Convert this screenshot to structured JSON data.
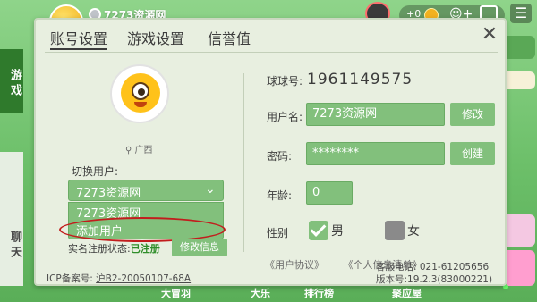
{
  "top": {
    "player_name": "7273资源网",
    "coins_plus": "+0"
  },
  "side": {
    "game_tab": "游戏",
    "chat_tab": "聊天"
  },
  "bottom_nav": [
    "大冒羽",
    "大乐",
    "排行榜",
    "聚应屋"
  ],
  "dialog": {
    "tabs": [
      "账号设置",
      "游戏设置",
      "信誉值"
    ],
    "close_label": "✕",
    "location": "广西",
    "switch_user_label": "切换用户:",
    "selected_user": "7273资源网",
    "dropdown_options": [
      "7273资源网",
      "添加用户"
    ],
    "real_name_label": "实名注册状态:",
    "real_name_status": "已注册",
    "modify_info_button": "修改信息",
    "icp_label": "ICP备案号:",
    "icp_number": "沪B2-20050107-68A",
    "account_no_label": "球球号:",
    "account_no": "1961149575",
    "username_label": "用户名:",
    "username_value": "7273资源网",
    "modify_button": "修改",
    "password_label": "密码:",
    "password_value": "********",
    "create_button": "创建",
    "age_label": "年龄:",
    "age_value": "0",
    "gender_label": "性别",
    "male_label": "男",
    "female_label": "女",
    "agreement_link": "《用户协议》",
    "personal_info_link": "《个人信息清单》",
    "service_phone": "客服电话: 021-61205656",
    "version": "版本号:19.2.3(83000221)"
  },
  "colors": {
    "accent_green": "#82c07c",
    "highlight_red": "#c21d1d",
    "dialog_bg": "#e8efe0"
  }
}
